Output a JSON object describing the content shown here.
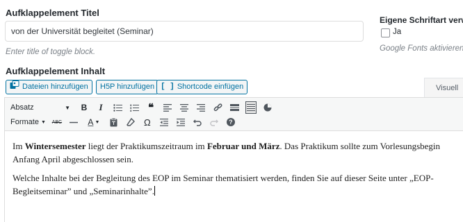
{
  "title_field": {
    "label": "Aufklappelement Titel",
    "value": "von der Universität begleitet (Seminar)",
    "hint": "Enter title of toggle block."
  },
  "font_option": {
    "label": "Eigene Schriftart verw",
    "checkbox_label": "Ja",
    "hint": "Google Fonts aktivieren"
  },
  "content_field": {
    "label": "Aufklappelement Inhalt"
  },
  "media_buttons": {
    "add_files": "Dateien hinzufügen",
    "h5p": "H5P hinzufügen",
    "shortcode": "Shortcode einfügen"
  },
  "editor_tabs": {
    "visual": "Visuell"
  },
  "toolbar": {
    "format_select": "Absatz",
    "formats_menu": "Formate",
    "bold": "B",
    "italic": "I",
    "omega": "Ω",
    "help": "?"
  },
  "body": {
    "p1_a": "Im ",
    "p1_b": "Wintersemester",
    "p1_c": " liegt der Praktikumszeitraum im ",
    "p1_d": "Februar und März",
    "p1_e": ". Das Praktikum sollte zum Vorlesungsbegin",
    "p1_f": "Anfang April abgeschlossen sein.",
    "p2_a": "Welche Inhalte bei der Begleitung des EOP im Seminar thematisiert werden, finden Sie auf dieser Seite unter „EOP-",
    "p2_b": "Begleitseminar” und „Seminarinhalte”."
  },
  "colors": {
    "accent": "#0071a1",
    "toolbar_bg": "#f6f7f7",
    "border": "#dddddd"
  }
}
